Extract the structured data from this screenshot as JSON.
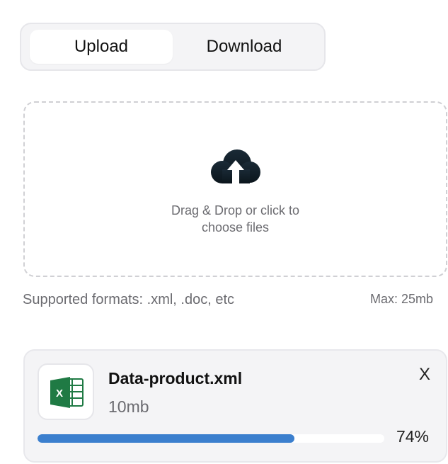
{
  "tabs": [
    {
      "label": "Upload",
      "active": true
    },
    {
      "label": "Download",
      "active": false
    }
  ],
  "dropzone": {
    "icon": "cloud-upload-icon",
    "line1": "Drag & Drop or click to",
    "line2": "choose files"
  },
  "formats_text": "Supported formats: .xml, .doc, etc",
  "max_text": "Max: 25mb",
  "file": {
    "icon": "excel-icon",
    "name": "Data-product.xml",
    "size": "10mb",
    "close_label": "X",
    "progress": 74,
    "progress_label": "74%"
  },
  "colors": {
    "accent": "#3b7fce",
    "excel_green": "#1f7a44",
    "cloud": "#0f1c24"
  }
}
